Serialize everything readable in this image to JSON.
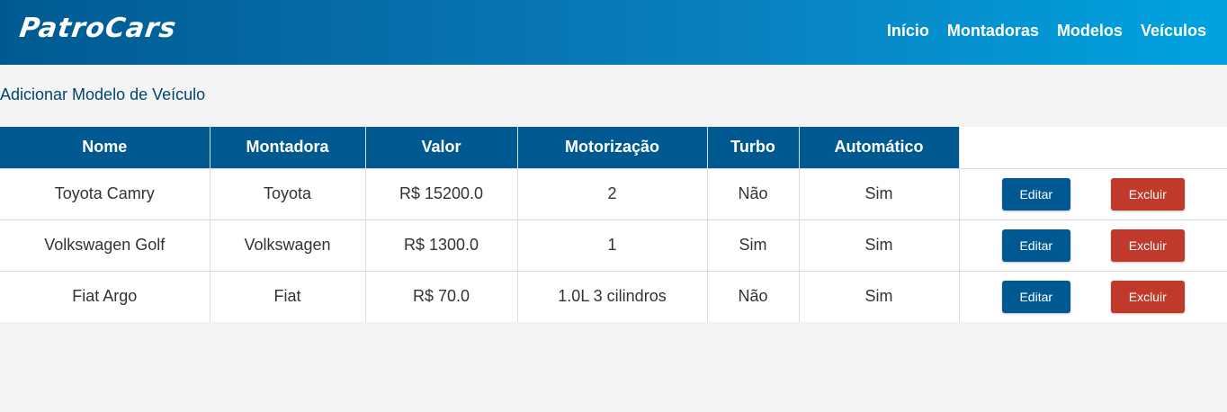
{
  "brand": "PatroCars",
  "nav": [
    "Início",
    "Montadoras",
    "Modelos",
    "Veículos"
  ],
  "add_link": "Adicionar Modelo de Veículo",
  "table": {
    "headers": [
      "Nome",
      "Montadora",
      "Valor",
      "Motorização",
      "Turbo",
      "Automático"
    ],
    "rows": [
      [
        "Toyota Camry",
        "Toyota",
        "R$ 15200.0",
        "2",
        "Não",
        "Sim"
      ],
      [
        "Volkswagen Golf",
        "Volkswagen",
        "R$ 1300.0",
        "1",
        "Sim",
        "Sim"
      ],
      [
        "Fiat Argo",
        "Fiat",
        "R$ 70.0",
        "1.0L 3 cilindros",
        "Não",
        "Sim"
      ]
    ],
    "edit_label": "Editar",
    "delete_label": "Excluir"
  },
  "colors": {
    "primary": "#005a91",
    "danger": "#c0392b",
    "background": "#f3f3f3"
  }
}
